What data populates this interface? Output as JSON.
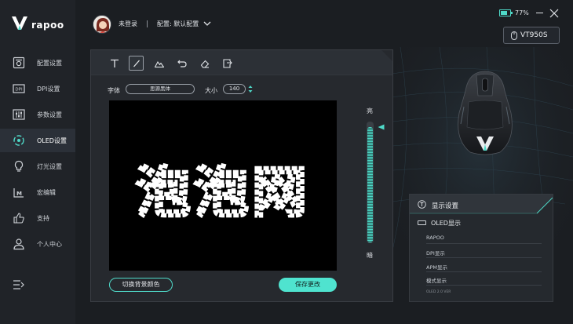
{
  "app": {
    "brand": "rapoo"
  },
  "sidebar": {
    "items": [
      {
        "label": "配置设置",
        "icon": "config-icon"
      },
      {
        "label": "DPI设置",
        "icon": "dpi-icon"
      },
      {
        "label": "参数设置",
        "icon": "sliders-icon"
      },
      {
        "label": "OLED设置",
        "icon": "oled-icon",
        "active": true
      },
      {
        "label": "灯光设置",
        "icon": "bulb-icon"
      },
      {
        "label": "宏编辑",
        "icon": "macro-icon"
      },
      {
        "label": "支持",
        "icon": "thumbs-up-icon"
      },
      {
        "label": "个人中心",
        "icon": "user-icon"
      }
    ]
  },
  "header": {
    "login": "未登录",
    "config": "配置: 默认配置",
    "battery": "77%",
    "battery_level": 0.77,
    "device": "VT950S"
  },
  "editor": {
    "font_label": "字体",
    "font_value": "思源黑体",
    "size_label": "大小",
    "size_value": "140",
    "preview_text": "泡泡网",
    "brightness_high": "亮",
    "brightness_low": "暗",
    "brightness_level": 0.96,
    "bg_color_button": "切换背景颜色",
    "save_button": "保存更改"
  },
  "display_settings": {
    "title": "显示设置",
    "section": "OLED显示",
    "items": [
      "RAPOO",
      "DPI显示",
      "APM显示",
      "模式显示"
    ],
    "footer": "OLED 2.0 VER"
  },
  "colors": {
    "accent": "#4fd9c8",
    "save_bg": "#4fe3cf",
    "panel": "#26292e",
    "background": "#1b1e22"
  }
}
